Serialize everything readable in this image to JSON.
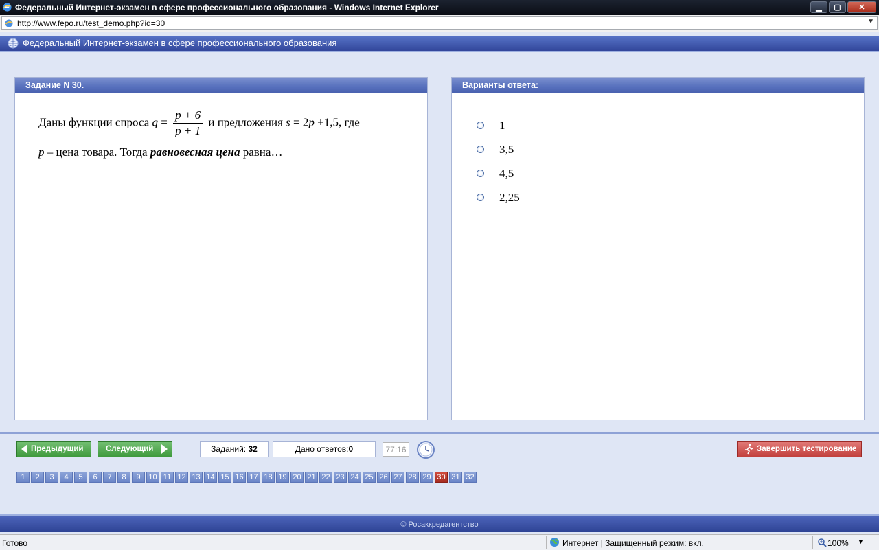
{
  "window": {
    "title": "Федеральный Интернет-экзамен в сфере профессионального образования - Windows Internet Explorer",
    "minimize": "▁",
    "maximize": "▢",
    "close": "✕"
  },
  "address_bar": {
    "url": "http://www.fepo.ru/test_demo.php?id=30",
    "dropdown": "▼"
  },
  "site": {
    "title": "Федеральный Интернет-экзамен в сфере профессионального образования"
  },
  "task": {
    "header": "Задание N 30.",
    "text_1": "Даны функции спроса",
    "q_var": "q",
    "eq": "=",
    "q_num": "p + 6",
    "q_den": "p + 1",
    "text_2": "и предложения",
    "s_formula_var": "s",
    "s_formula_rest": "= 2",
    "s_formula_p": "p",
    "s_formula_tail": "+1,5",
    "text_3": ", где",
    "p_var": "p",
    "text_4": "– цена товара. Тогда",
    "emphasis": "равновесная цена",
    "text_5": "равна…"
  },
  "answers": {
    "header": "Варианты ответа:",
    "options": [
      "1",
      "3,5",
      "4,5",
      "2,25"
    ]
  },
  "controls": {
    "prev_label": "Предыдущий",
    "next_label": "Следующий",
    "tasks_label": "Заданий:",
    "tasks_count": "32",
    "answered_label": "Дано ответов:",
    "answered_count": "0",
    "timer": "77:16",
    "finish_label": "Завершить тестирование"
  },
  "pager": {
    "pages": [
      "1",
      "2",
      "3",
      "4",
      "5",
      "6",
      "7",
      "8",
      "9",
      "10",
      "11",
      "12",
      "13",
      "14",
      "15",
      "16",
      "17",
      "18",
      "19",
      "20",
      "21",
      "22",
      "23",
      "24",
      "25",
      "26",
      "27",
      "28",
      "29",
      "30",
      "31",
      "32"
    ],
    "current": "30"
  },
  "footer": {
    "copyright": "© Росаккредагентство"
  },
  "status_bar": {
    "ready": "Готово",
    "zone": "Интернет | Защищенный режим: вкл.",
    "zoom": "100%",
    "zoom_dd": "▼"
  },
  "colors": {
    "header_blue": "#33479b",
    "panel_header": "#5770bd",
    "nav_green": "#3f9a3d",
    "finish_red": "#c2403d",
    "current_page": "#a62d22"
  }
}
